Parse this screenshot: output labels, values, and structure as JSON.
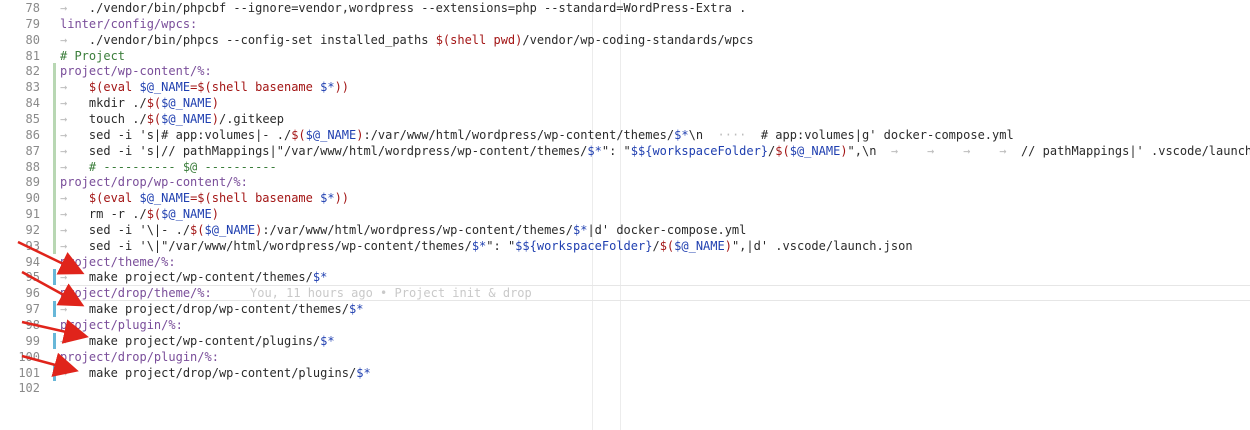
{
  "editor": {
    "blame": "You, 11 hours ago • Project init & drop",
    "lines": [
      {
        "n": "78",
        "gutter": "",
        "tokens": [
          [
            "dim",
            "→ "
          ],
          [
            "str",
            "  ./vendor/bin/phpcbf --ignore=vendor,wordpress --extensions=php --standard=WordPress-Extra ."
          ]
        ]
      },
      {
        "n": "79",
        "gutter": "",
        "tokens": [
          [
            "tgt",
            "linter/config/wpcs:"
          ]
        ]
      },
      {
        "n": "80",
        "gutter": "",
        "tokens": [
          [
            "dim",
            "→ "
          ],
          [
            "str",
            "  ./vendor/bin/phpcs --config-set installed_paths "
          ],
          [
            "fn",
            "$(shell pwd)"
          ],
          [
            "str",
            "/vendor/wp-coding-standards/wpcs"
          ]
        ]
      },
      {
        "n": "81",
        "gutter": "",
        "tokens": [
          [
            "cmt",
            "# Project"
          ]
        ]
      },
      {
        "n": "82",
        "gutter": "mod",
        "tokens": [
          [
            "tgt",
            "project/wp-content/%:"
          ]
        ]
      },
      {
        "n": "83",
        "gutter": "mod",
        "tokens": [
          [
            "dim",
            "→ "
          ],
          [
            "fn",
            "  $(eval "
          ],
          [
            "var",
            "$@_NAME"
          ],
          [
            "fn",
            "=$(shell basename "
          ],
          [
            "var",
            "$*"
          ],
          [
            "fn",
            "))"
          ]
        ]
      },
      {
        "n": "84",
        "gutter": "mod",
        "tokens": [
          [
            "dim",
            "→ "
          ],
          [
            "str",
            "  mkdir ./"
          ],
          [
            "fn",
            "$("
          ],
          [
            "var",
            "$@_NAME"
          ],
          [
            "fn",
            ")"
          ]
        ]
      },
      {
        "n": "85",
        "gutter": "mod",
        "tokens": [
          [
            "dim",
            "→ "
          ],
          [
            "str",
            "  touch ./"
          ],
          [
            "fn",
            "$("
          ],
          [
            "var",
            "$@_NAME"
          ],
          [
            "fn",
            ")"
          ],
          [
            "str",
            "/.gitkeep"
          ]
        ]
      },
      {
        "n": "86",
        "gutter": "mod",
        "tokens": [
          [
            "dim",
            "→ "
          ],
          [
            "str",
            "  sed -i 's|# app:volumes|- ./"
          ],
          [
            "fn",
            "$("
          ],
          [
            "var",
            "$@_NAME"
          ],
          [
            "fn",
            ")"
          ],
          [
            "str",
            ":/var/www/html/wordpress/wp-content/themes/"
          ],
          [
            "var",
            "$*"
          ],
          [
            "str",
            "\\n"
          ],
          [
            "dim",
            "  ····  "
          ],
          [
            "str",
            "# app:volumes|g' docker-compose.yml"
          ]
        ]
      },
      {
        "n": "87",
        "gutter": "mod",
        "tokens": [
          [
            "dim",
            "→ "
          ],
          [
            "str",
            "  sed -i 's|// pathMappings|\"/var/www/html/wordpress/wp-content/themes/"
          ],
          [
            "var",
            "$*"
          ],
          [
            "str",
            "\": \""
          ],
          [
            "var",
            "$${workspaceFolder}"
          ],
          [
            "str",
            "/"
          ],
          [
            "fn",
            "$("
          ],
          [
            "var",
            "$@_NAME"
          ],
          [
            "fn",
            ")"
          ],
          [
            "str",
            "\",\\n"
          ],
          [
            "dim",
            "  →    →    →    →  "
          ],
          [
            "str",
            "// pathMappings|' .vscode/launch.json"
          ]
        ]
      },
      {
        "n": "88",
        "gutter": "mod",
        "tokens": [
          [
            "dim",
            "→ "
          ],
          [
            "cmt",
            "  # ---------- $@ ----------"
          ]
        ]
      },
      {
        "n": "89",
        "gutter": "mod",
        "tokens": [
          [
            "tgt",
            "project/drop/wp-content/%:"
          ]
        ]
      },
      {
        "n": "90",
        "gutter": "mod",
        "tokens": [
          [
            "dim",
            "→ "
          ],
          [
            "fn",
            "  $(eval "
          ],
          [
            "var",
            "$@_NAME"
          ],
          [
            "fn",
            "=$(shell basename "
          ],
          [
            "var",
            "$*"
          ],
          [
            "fn",
            "))"
          ]
        ]
      },
      {
        "n": "91",
        "gutter": "mod",
        "tokens": [
          [
            "dim",
            "→ "
          ],
          [
            "str",
            "  rm -r ./"
          ],
          [
            "fn",
            "$("
          ],
          [
            "var",
            "$@_NAME"
          ],
          [
            "fn",
            ")"
          ]
        ]
      },
      {
        "n": "92",
        "gutter": "mod",
        "tokens": [
          [
            "dim",
            "→ "
          ],
          [
            "str",
            "  sed -i '\\|- ./"
          ],
          [
            "fn",
            "$("
          ],
          [
            "var",
            "$@_NAME"
          ],
          [
            "fn",
            ")"
          ],
          [
            "str",
            ":/var/www/html/wordpress/wp-content/themes/"
          ],
          [
            "var",
            "$*"
          ],
          [
            "str",
            "|d' docker-compose.yml"
          ]
        ]
      },
      {
        "n": "93",
        "gutter": "mod",
        "tokens": [
          [
            "dim",
            "→ "
          ],
          [
            "str",
            "  sed -i '\\|\"/var/www/html/wordpress/wp-content/themes/"
          ],
          [
            "var",
            "$*"
          ],
          [
            "str",
            "\": \""
          ],
          [
            "var",
            "$${workspaceFolder}"
          ],
          [
            "str",
            "/"
          ],
          [
            "fn",
            "$("
          ],
          [
            "var",
            "$@_NAME"
          ],
          [
            "fn",
            ")"
          ],
          [
            "str",
            "\",|d' .vscode/launch.json"
          ]
        ]
      },
      {
        "n": "94",
        "gutter": "",
        "tokens": [
          [
            "tgt",
            "project/theme/%:"
          ]
        ]
      },
      {
        "n": "95",
        "gutter": "add",
        "tokens": [
          [
            "dim",
            "→ "
          ],
          [
            "str",
            "  make project/wp-content/themes/"
          ],
          [
            "var",
            "$*"
          ]
        ]
      },
      {
        "n": "96",
        "gutter": "",
        "tokens": [
          [
            "tgt",
            "project/drop/theme/%:"
          ]
        ]
      },
      {
        "n": "97",
        "gutter": "add",
        "tokens": [
          [
            "dim",
            "→ "
          ],
          [
            "str",
            "  make project/drop/wp-content/themes/"
          ],
          [
            "var",
            "$*"
          ]
        ]
      },
      {
        "n": "98",
        "gutter": "",
        "tokens": [
          [
            "tgt",
            "project/plugin/%:"
          ]
        ]
      },
      {
        "n": "99",
        "gutter": "add",
        "tokens": [
          [
            "dim",
            "→ "
          ],
          [
            "str",
            "  make project/wp-content/plugins/"
          ],
          [
            "var",
            "$*"
          ]
        ]
      },
      {
        "n": "100",
        "gutter": "",
        "tokens": [
          [
            "tgt",
            "project/drop/plugin/%:"
          ]
        ]
      },
      {
        "n": "101",
        "gutter": "add",
        "tokens": [
          [
            "dim",
            "→ "
          ],
          [
            "str",
            "  make project/drop/wp-content/plugins/"
          ],
          [
            "var",
            "$*"
          ]
        ]
      },
      {
        "n": "102",
        "gutter": "",
        "tokens": []
      }
    ]
  },
  "colors": {
    "target": "#7a4e9a",
    "comment": "#3a7d3a",
    "variable": "#1f3fb0",
    "function": "#a31515",
    "gutter_modified": "#b8d7b3",
    "gutter_added": "#68b7d8",
    "annotation_arrow": "#e0241b"
  }
}
